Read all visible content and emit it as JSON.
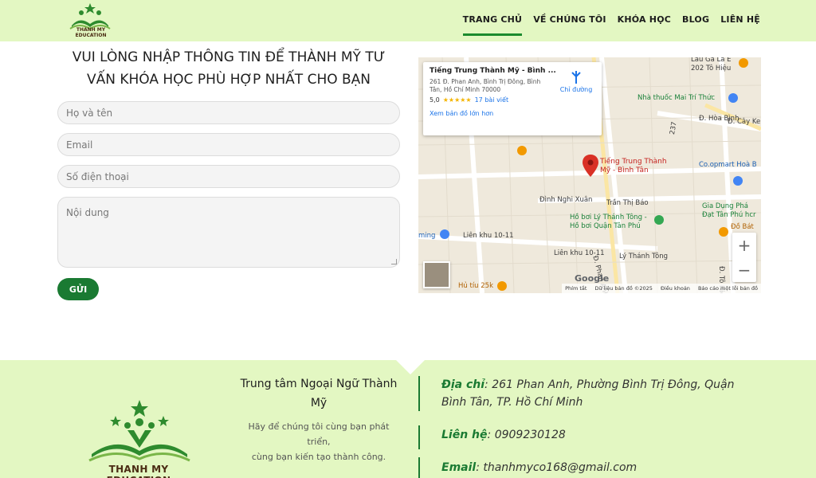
{
  "header": {
    "logo_text": "THANH MY EDUCATION",
    "nav": [
      "TRANG CHỦ",
      "VỀ CHÚNG TÔI",
      "KHÓA HỌC",
      "BLOG",
      "LIÊN HỆ"
    ],
    "active_nav": "TRANG CHỦ"
  },
  "form": {
    "title": "VUI LÒNG NHẬP THÔNG TIN ĐỂ THÀNH MỸ TƯ VẤN KHÓA HỌC PHÙ HỢP NHẤT CHO BẠN",
    "name_placeholder": "Họ và tên",
    "email_placeholder": "Email",
    "phone_placeholder": "Số điện thoại",
    "content_placeholder": "Nội dung",
    "submit_label": "GỬI"
  },
  "map": {
    "card_title": "Tiếng Trung Thành Mỹ - Bình ...",
    "card_address": "261 Đ. Phan Anh, Bình Trị Đông, Bình Tân, Hồ Chí Minh 70000",
    "rating": "5,0",
    "stars": "★★★★★",
    "reviews": "17 bài viết",
    "larger_map_link": "Xem bản đồ lớn hơn",
    "directions": "Chỉ đường",
    "pin_label": "Tiếng Trung Thành Mỹ - Bình Tân",
    "labels": {
      "lau_ga": "Lẩu Gà Lá É",
      "to_hieu": "202 Tô Hiệu",
      "nha_thuoc": "Nhà thuốc Mai Trí Thức",
      "hoa_binh": "Đ. Hòa Bình",
      "cay_keo": "Đ. Cây Ke",
      "coopmart": "Co.opmart Hoà B",
      "nghi_xuan": "Đình Nghi Xuân",
      "tran_thi_bao": "Trần Thị Báo",
      "ho_boi": "Hồ bơi Lý Thánh Tông - Hồ bơi Quận Tân Phú",
      "gia_dung": "Gia Dụng Phá",
      "dat_tan_phu": "Đạt Tân Phú hcr",
      "do_bat": "Đồ Bát",
      "lien_khu_1": "Liên khu 10-11",
      "lien_khu_2": "Liên khu 10-11",
      "ly_thanh_tong": "Lý Thánh Tông",
      "phan_anh": "Đ. Phan Anh",
      "hu_tiu": "Hủ tíu 25k",
      "ming": "ming",
      "to_hieu_v": "Đ. Tô Hiệu",
      "road_237": "237"
    },
    "google": "Google",
    "footer_items": [
      "Phím tắt",
      "Dữ liệu bản đồ ©2025",
      "Điều khoản",
      "Báo cáo một lỗi bản đồ"
    ],
    "zoom_in": "+",
    "zoom_out": "−"
  },
  "footer": {
    "logo_text": "THANH MY EDUCATION",
    "center_title": "Trung tâm Ngoại Ngữ Thành Mỹ",
    "center_text_1": "Hãy để chúng tôi cùng bạn phát triển,",
    "center_text_2": "cùng bạn kiến tạo thành công.",
    "address_label": "Địa chỉ",
    "address_value": ": 261 Phan Anh, Phường Bình Trị Đông, Quận Bình Tân, TP. Hồ Chí Minh",
    "phone_label": "Liên hệ",
    "phone_value": ": 0909230128",
    "email_label": "Email",
    "email_value": ": thanhmyco168@gmail.com"
  },
  "colors": {
    "brand_green": "#1a7a32",
    "header_bg": "#e3f7c2",
    "accent_orange": "#f4b400"
  }
}
